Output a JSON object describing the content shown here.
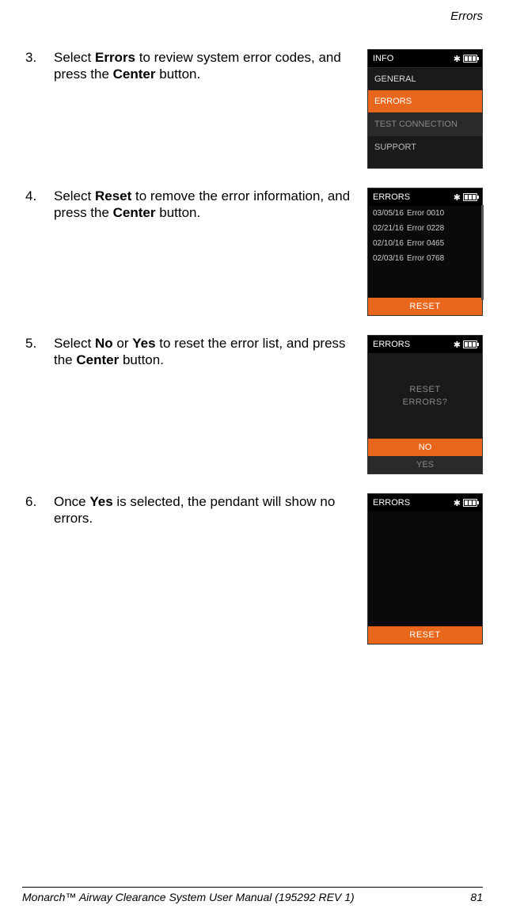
{
  "header": {
    "title": "Errors"
  },
  "steps": [
    {
      "num": "3.",
      "text_pre": "Select ",
      "bold1": "Errors",
      "text_mid": " to review system error codes, and press the ",
      "bold2": "Center",
      "text_post": " button."
    },
    {
      "num": "4.",
      "text_pre": "Select ",
      "bold1": "Reset",
      "text_mid": " to remove the error information, and press the ",
      "bold2": "Center",
      "text_post": " button."
    },
    {
      "num": "5.",
      "text_pre": "Select ",
      "bold1": "No",
      "text_or": " or ",
      "bold1b": "Yes",
      "text_mid": " to reset the error list, and press the ",
      "bold2": "Center",
      "text_post": " button."
    },
    {
      "num": "6.",
      "text_pre": "Once ",
      "bold1": "Yes",
      "text_mid": " is selected, the pendant will show no errors.",
      "bold2": "",
      "text_post": ""
    }
  ],
  "pendant1": {
    "title": "INFO",
    "items": {
      "general": "GENERAL",
      "errors": "ERRORS",
      "test": "TEST CONNECTION",
      "support": "SUPPORT"
    }
  },
  "pendant2": {
    "title": "ERRORS",
    "rows": [
      {
        "date": "03/05/16",
        "code": "Error 0010"
      },
      {
        "date": "02/21/16",
        "code": "Error 0228"
      },
      {
        "date": "02/10/16",
        "code": "Error 0465"
      },
      {
        "date": "02/03/16",
        "code": "Error 0768"
      }
    ],
    "reset": "RESET"
  },
  "pendant3": {
    "title": "ERRORS",
    "prompt_l1": "RESET",
    "prompt_l2": "ERRORS?",
    "no": "NO",
    "yes": "YES"
  },
  "pendant4": {
    "title": "ERRORS",
    "reset": "RESET"
  },
  "footer": {
    "left": "Monarch™ Airway Clearance System User Manual (195292 REV 1)",
    "right": "81"
  }
}
